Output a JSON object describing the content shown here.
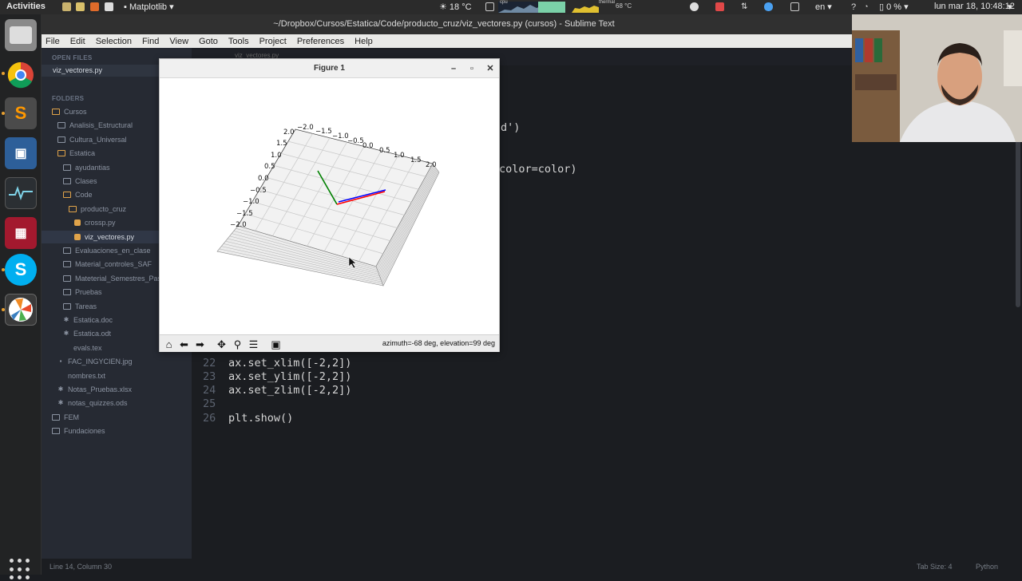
{
  "topbar": {
    "activities": "Activities",
    "app_menu": "Matplotlib",
    "weather": "18 °C",
    "cpu_label": "cpu",
    "thermal_label": "thermal",
    "temp": "68 °C",
    "lang": "en",
    "battery": "0 %",
    "clock": "lun mar 18, 10:48:12"
  },
  "window": {
    "title": "~/Dropbox/Cursos/Estatica/Code/producto_cruz/viz_vectores.py (cursos) - Sublime Text"
  },
  "menu": [
    "File",
    "Edit",
    "Selection",
    "Find",
    "View",
    "Goto",
    "Tools",
    "Project",
    "Preferences",
    "Help"
  ],
  "sidebar": {
    "open_files_header": "OPEN FILES",
    "open_file": "viz_vectores.py",
    "folders_header": "FOLDERS",
    "tree": [
      {
        "label": "Cursos",
        "type": "folder-open"
      },
      {
        "label": "Analisis_Estructural",
        "type": "folder"
      },
      {
        "label": "Cultura_Universal",
        "type": "folder"
      },
      {
        "label": "Estatica",
        "type": "folder-open"
      },
      {
        "label": "ayudantias",
        "type": "folder"
      },
      {
        "label": "Clases",
        "type": "folder"
      },
      {
        "label": "Code",
        "type": "folder-open"
      },
      {
        "label": "producto_cruz",
        "type": "folder-open"
      },
      {
        "label": "crossp.py",
        "type": "py"
      },
      {
        "label": "viz_vectores.py",
        "type": "py"
      },
      {
        "label": "Evaluaciones_en_clase",
        "type": "folder"
      },
      {
        "label": "Material_controles_SAF",
        "type": "folder"
      },
      {
        "label": "Mateterial_Semestres_Pasa",
        "type": "folder"
      },
      {
        "label": "Pruebas",
        "type": "folder"
      },
      {
        "label": "Tareas",
        "type": "folder"
      },
      {
        "label": "Estatica.doc",
        "type": "doc"
      },
      {
        "label": "Estatica.odt",
        "type": "doc"
      },
      {
        "label": "evals.tex",
        "type": "file"
      },
      {
        "label": "FAC_INGYCIEN.jpg",
        "type": "img"
      },
      {
        "label": "nombres.txt",
        "type": "file"
      },
      {
        "label": "Notas_Pruebas.xlsx",
        "type": "doc"
      },
      {
        "label": "notas_quizzes.ods",
        "type": "doc"
      },
      {
        "label": "FEM",
        "type": "folder"
      },
      {
        "label": "Fundaciones",
        "type": "folder"
      }
    ]
  },
  "editor": {
    "tab": "viz_vectores.py",
    "fragment_1": "d')",
    "fragment_2": "color=color)",
    "lines": [
      {
        "num": "22",
        "code": "ax.set_xlim([-2,2])"
      },
      {
        "num": "23",
        "code": "ax.set_ylim([-2,2])"
      },
      {
        "num": "24",
        "code": "ax.set_zlim([-2,2])"
      },
      {
        "num": "25",
        "code": ""
      },
      {
        "num": "26",
        "code": "plt.show()"
      }
    ]
  },
  "statusbar": {
    "position": "Line 14, Column 30",
    "tab_size": "Tab Size: 4",
    "syntax": "Python"
  },
  "figure": {
    "title": "Figure 1",
    "status": "azimuth=-68 deg, elevation=99 deg",
    "tick_labels_top": [
      "−2.0",
      "−1.5",
      "−1.0",
      "−0.5",
      "0.0",
      "0.5",
      "1.0",
      "1.5",
      "2.0"
    ],
    "tick_labels_left": [
      "2.0",
      "1.5",
      "1.0",
      "0.5",
      "0.0",
      "−0.5",
      "−1.0",
      "−1.5",
      "−2.0"
    ],
    "vector_colors": [
      "#ff0000",
      "#008000",
      "#0000ff"
    ]
  }
}
